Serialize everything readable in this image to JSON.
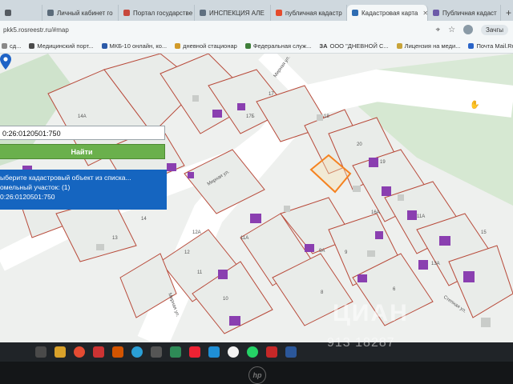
{
  "tabs": [
    {
      "label": "",
      "color": "#555b61"
    },
    {
      "label": "Личный кабинет го",
      "color": "#5b6b7a"
    },
    {
      "label": "Портал государстве",
      "color": "#c7483c"
    },
    {
      "label": "ИНСПЕКЦИЯ АЛЕ",
      "color": "#607080"
    },
    {
      "label": "публичная кадастр",
      "color": "#e54b2c"
    },
    {
      "label": "Кадастровая карта",
      "color": "#2f6db3",
      "active": true
    },
    {
      "label": "Публичная кадаст",
      "color": "#6c5aa8"
    }
  ],
  "address": {
    "url": "pkk5.rosreestr.ru/#map",
    "profile": "Зачгы"
  },
  "bookmarks": [
    {
      "label": "сд...",
      "color": "#888"
    },
    {
      "label": "Медицинский порт...",
      "color": "#4a4a4a"
    },
    {
      "label": "МКБ-10 онлайн, ко...",
      "color": "#2b5aa8"
    },
    {
      "label": "дневной стационар",
      "color": "#d19a2a"
    },
    {
      "label": "Федеральная служ...",
      "color": "#3f7f3a"
    },
    {
      "label": "ООО \"ДНЕВНОЙ С...",
      "color": "#a33"
    },
    {
      "label": "Лицензия на меди...",
      "color": "#c8a43a"
    },
    {
      "label": "Почта Mail.Ru",
      "color": "#2a64c8"
    }
  ],
  "bookmark_prefix": "ЗА",
  "search": {
    "value": "0:26:0120501:750",
    "button": "Найти"
  },
  "result": {
    "line1": "ыберите кадастровый объект из списка...",
    "line2": "омельный участок: (1)",
    "line3": "0:26:0120501:750"
  },
  "map_labels": {
    "streets": [
      "Мирная ул.",
      "Мирная ул.",
      "Мирная ул.",
      "Степная ул."
    ],
    "parcels": [
      "14А",
      "17",
      "17Б",
      "18",
      "20",
      "19",
      "16А",
      "11А",
      "14",
      "12А",
      "13",
      "12",
      "11А",
      "11",
      "9А",
      "9",
      "10",
      "8",
      "6",
      "13А",
      "15"
    ]
  },
  "watermark": {
    "main": "ЦИАН",
    "number": "913 18287"
  },
  "taskbar_icons": [
    "explorer-icon",
    "chrome-icon",
    "app-icon",
    "app2-icon",
    "telegram-icon",
    "app3-icon",
    "browser-icon",
    "yandex-icon",
    "edge-icon",
    "yandex-browser-icon",
    "whatsapp-icon",
    "pdf-icon",
    "word-icon"
  ],
  "colors": {
    "accent_blue": "#1565c0",
    "find_green": "#6ab04c",
    "parcel_line": "#b84a3a",
    "building": "#8a3fb0"
  }
}
